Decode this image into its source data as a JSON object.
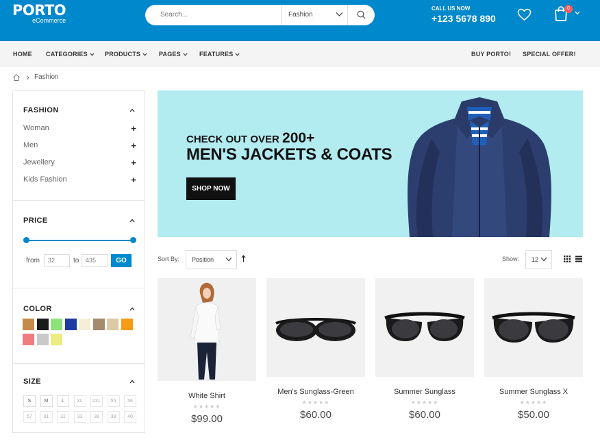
{
  "header": {
    "logo_main": "PORTO",
    "logo_sub": "eCommerce",
    "search_placeholder": "Search...",
    "search_category": "Fashion",
    "callus_label": "CALL US NOW",
    "phone": "+123 5678 890",
    "cart_count": "0",
    "brand_color": "#0088cc"
  },
  "nav": {
    "items": [
      "HOME",
      "CATEGORIES",
      "PRODUCTS",
      "PAGES",
      "FEATURES"
    ],
    "right_items": [
      "BUY PORTO!",
      "SPECIAL OFFER!"
    ]
  },
  "breadcrumb": {
    "current": "Fashion"
  },
  "sidebar": {
    "fashion": {
      "title": "FASHION",
      "items": [
        "Woman",
        "Men",
        "Jewellery",
        "Kids Fashion"
      ]
    },
    "price": {
      "title": "PRICE",
      "from_label": "from",
      "to_label": "to",
      "min": "32",
      "max": "435",
      "go_label": "GO"
    },
    "color": {
      "title": "COLOR",
      "swatches": [
        "#c68a4a",
        "#1a1a1a",
        "#8ee27a",
        "#1f3aa3",
        "#f6efd8",
        "#a68a6c",
        "#dcc9a6",
        "#f79a14",
        "#f17b7f",
        "#c9c9c9",
        "#ecec80"
      ]
    },
    "size": {
      "title": "SIZE",
      "row1": [
        "S",
        "M",
        "L",
        "XL",
        "2XL",
        "55",
        "56"
      ],
      "row2": [
        "57",
        "31",
        "32",
        "33",
        "38",
        "39",
        "40"
      ]
    }
  },
  "banner": {
    "line1": "CHECK OUT OVER",
    "line1_number": "200+",
    "line2": "MEN'S JACKETS & COATS",
    "button": "SHOP NOW"
  },
  "toolbar": {
    "sort_label": "Sort By:",
    "sort_value": "Position",
    "show_label": "Show:",
    "show_value": "12"
  },
  "products": [
    {
      "name": "White Shirt",
      "price": "$99.00",
      "stars": "★★★★★"
    },
    {
      "name": "Men's Sunglass-Green",
      "price": "$60.00",
      "stars": "★★★★★"
    },
    {
      "name": "Summer Sunglass",
      "price": "$60.00",
      "stars": "★★★★★"
    },
    {
      "name": "Summer Sunglass X",
      "price": "$50.00",
      "stars": "★★★★★"
    }
  ]
}
